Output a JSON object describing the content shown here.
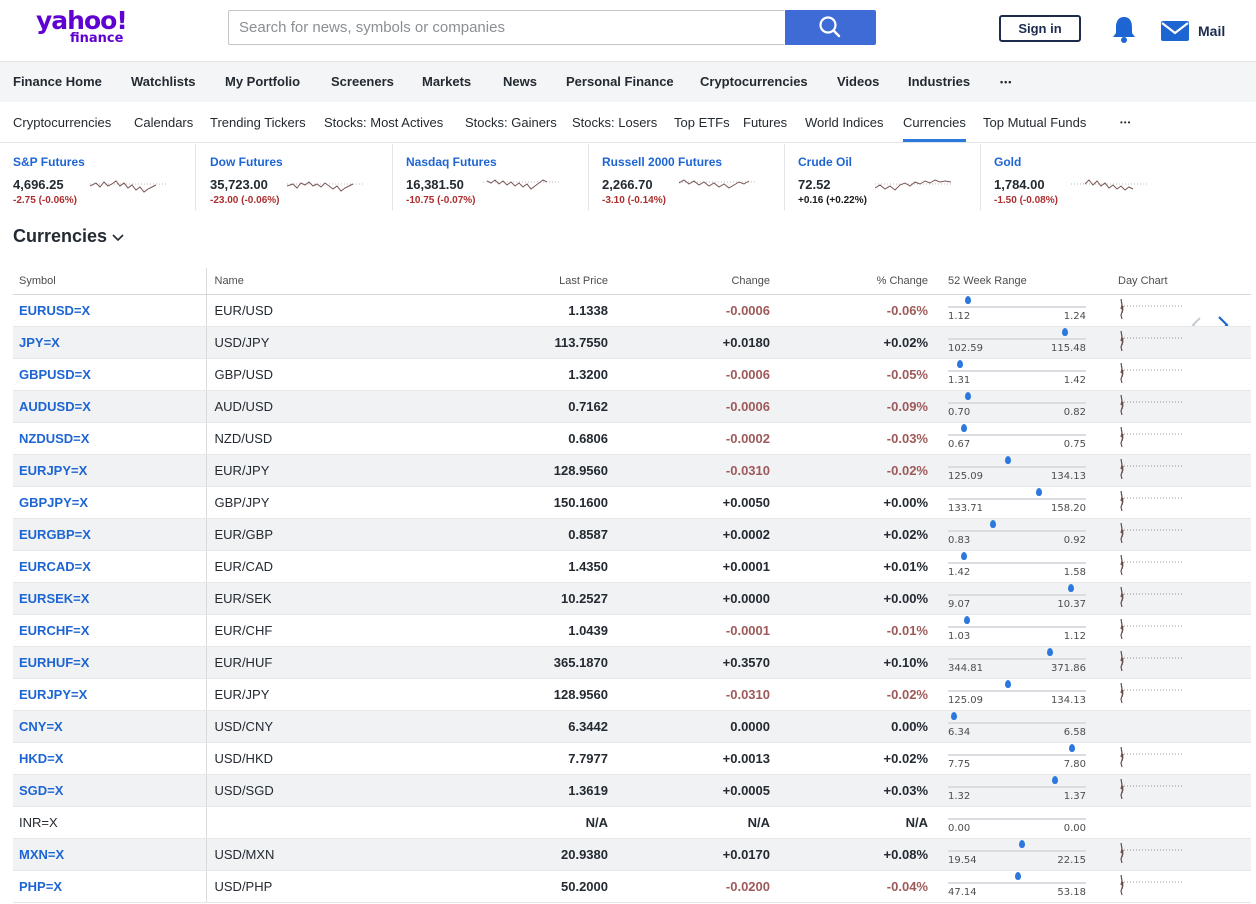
{
  "header": {
    "logo_text": "yahoo!",
    "logo_sub": "finance",
    "search_placeholder": "Search for news, symbols or companies",
    "signin_label": "Sign in",
    "mail_label": "Mail"
  },
  "nav": {
    "primary": [
      "Finance Home",
      "Watchlists",
      "My Portfolio",
      "Screeners",
      "Markets",
      "News",
      "Personal Finance",
      "Cryptocurrencies",
      "Videos",
      "Industries",
      "•••"
    ],
    "secondary": [
      "Cryptocurrencies",
      "Calendars",
      "Trending Tickers",
      "Stocks: Most Actives",
      "Stocks: Gainers",
      "Stocks: Losers",
      "Top ETFs",
      "Futures",
      "World Indices",
      "Currencies",
      "Top Mutual Funds",
      "•••"
    ],
    "active_secondary": "Currencies"
  },
  "tickers": [
    {
      "name": "S&P Futures",
      "price": "4,696.25",
      "change": "-2.75 (-0.06%)"
    },
    {
      "name": "Dow Futures",
      "price": "35,723.00",
      "change": "-23.00 (-0.06%)"
    },
    {
      "name": "Nasdaq Futures",
      "price": "16,381.50",
      "change": "-10.75 (-0.07%)"
    },
    {
      "name": "Russell 2000 Futures",
      "price": "2,266.70",
      "change": "-3.10 (-0.14%)"
    },
    {
      "name": "Crude Oil",
      "price": "72.52",
      "change": "+0.16 (+0.22%)"
    },
    {
      "name": "Gold",
      "price": "1,784.00",
      "change": "-1.50 (-0.08%)"
    }
  ],
  "page_title": "Currencies",
  "table": {
    "headers": {
      "symbol": "Symbol",
      "name": "Name",
      "last_price": "Last Price",
      "change": "Change",
      "pct_change": "% Change",
      "range": "52 Week Range",
      "day_chart": "Day Chart"
    },
    "rows": [
      {
        "symbol": "EURUSD=X",
        "name": "EUR/USD",
        "last": "1.1338",
        "change": "-0.0006",
        "pct": "-0.06%",
        "low": "1.12",
        "high": "1.24",
        "pos": 0.13
      },
      {
        "symbol": "JPY=X",
        "name": "USD/JPY",
        "last": "113.7550",
        "change": "+0.0180",
        "pct": "+0.02%",
        "low": "102.59",
        "high": "115.48",
        "pos": 0.86
      },
      {
        "symbol": "GBPUSD=X",
        "name": "GBP/USD",
        "last": "1.3200",
        "change": "-0.0006",
        "pct": "-0.05%",
        "low": "1.31",
        "high": "1.42",
        "pos": 0.07
      },
      {
        "symbol": "AUDUSD=X",
        "name": "AUD/USD",
        "last": "0.7162",
        "change": "-0.0006",
        "pct": "-0.09%",
        "low": "0.70",
        "high": "0.82",
        "pos": 0.13
      },
      {
        "symbol": "NZDUSD=X",
        "name": "NZD/USD",
        "last": "0.6806",
        "change": "-0.0002",
        "pct": "-0.03%",
        "low": "0.67",
        "high": "0.75",
        "pos": 0.1
      },
      {
        "symbol": "EURJPY=X",
        "name": "EUR/JPY",
        "last": "128.9560",
        "change": "-0.0310",
        "pct": "-0.02%",
        "low": "125.09",
        "high": "134.13",
        "pos": 0.43
      },
      {
        "symbol": "GBPJPY=X",
        "name": "GBP/JPY",
        "last": "150.1600",
        "change": "+0.0050",
        "pct": "+0.00%",
        "low": "133.71",
        "high": "158.20",
        "pos": 0.67
      },
      {
        "symbol": "EURGBP=X",
        "name": "EUR/GBP",
        "last": "0.8587",
        "change": "+0.0002",
        "pct": "+0.02%",
        "low": "0.83",
        "high": "0.92",
        "pos": 0.32
      },
      {
        "symbol": "EURCAD=X",
        "name": "EUR/CAD",
        "last": "1.4350",
        "change": "+0.0001",
        "pct": "+0.01%",
        "low": "1.42",
        "high": "1.58",
        "pos": 0.1
      },
      {
        "symbol": "EURSEK=X",
        "name": "EUR/SEK",
        "last": "10.2527",
        "change": "+0.0000",
        "pct": "+0.00%",
        "low": "9.07",
        "high": "10.37",
        "pos": 0.91
      },
      {
        "symbol": "EURCHF=X",
        "name": "EUR/CHF",
        "last": "1.0439",
        "change": "-0.0001",
        "pct": "-0.01%",
        "low": "1.03",
        "high": "1.12",
        "pos": 0.12
      },
      {
        "symbol": "EURHUF=X",
        "name": "EUR/HUF",
        "last": "365.1870",
        "change": "+0.3570",
        "pct": "+0.10%",
        "low": "344.81",
        "high": "371.86",
        "pos": 0.75
      },
      {
        "symbol": "EURJPY=X",
        "name": "EUR/JPY",
        "last": "128.9560",
        "change": "-0.0310",
        "pct": "-0.02%",
        "low": "125.09",
        "high": "134.13",
        "pos": 0.43
      },
      {
        "symbol": "CNY=X",
        "name": "USD/CNY",
        "last": "6.3442",
        "change": "0.0000",
        "pct": "0.00%",
        "low": "6.34",
        "high": "6.58",
        "pos": 0.02
      },
      {
        "symbol": "HKD=X",
        "name": "USD/HKD",
        "last": "7.7977",
        "change": "+0.0013",
        "pct": "+0.02%",
        "low": "7.75",
        "high": "7.80",
        "pos": 0.92
      },
      {
        "symbol": "SGD=X",
        "name": "USD/SGD",
        "last": "1.3619",
        "change": "+0.0005",
        "pct": "+0.03%",
        "low": "1.32",
        "high": "1.37",
        "pos": 0.79
      },
      {
        "symbol": "INR=X",
        "name": "",
        "last": "N/A",
        "change": "N/A",
        "pct": "N/A",
        "low": "0.00",
        "high": "0.00",
        "pos": null
      },
      {
        "symbol": "MXN=X",
        "name": "USD/MXN",
        "last": "20.9380",
        "change": "+0.0170",
        "pct": "+0.08%",
        "low": "19.54",
        "high": "22.15",
        "pos": 0.54
      },
      {
        "symbol": "PHP=X",
        "name": "USD/PHP",
        "last": "50.2000",
        "change": "-0.0200",
        "pct": "-0.04%",
        "low": "47.14",
        "high": "53.18",
        "pos": 0.51
      }
    ]
  }
}
